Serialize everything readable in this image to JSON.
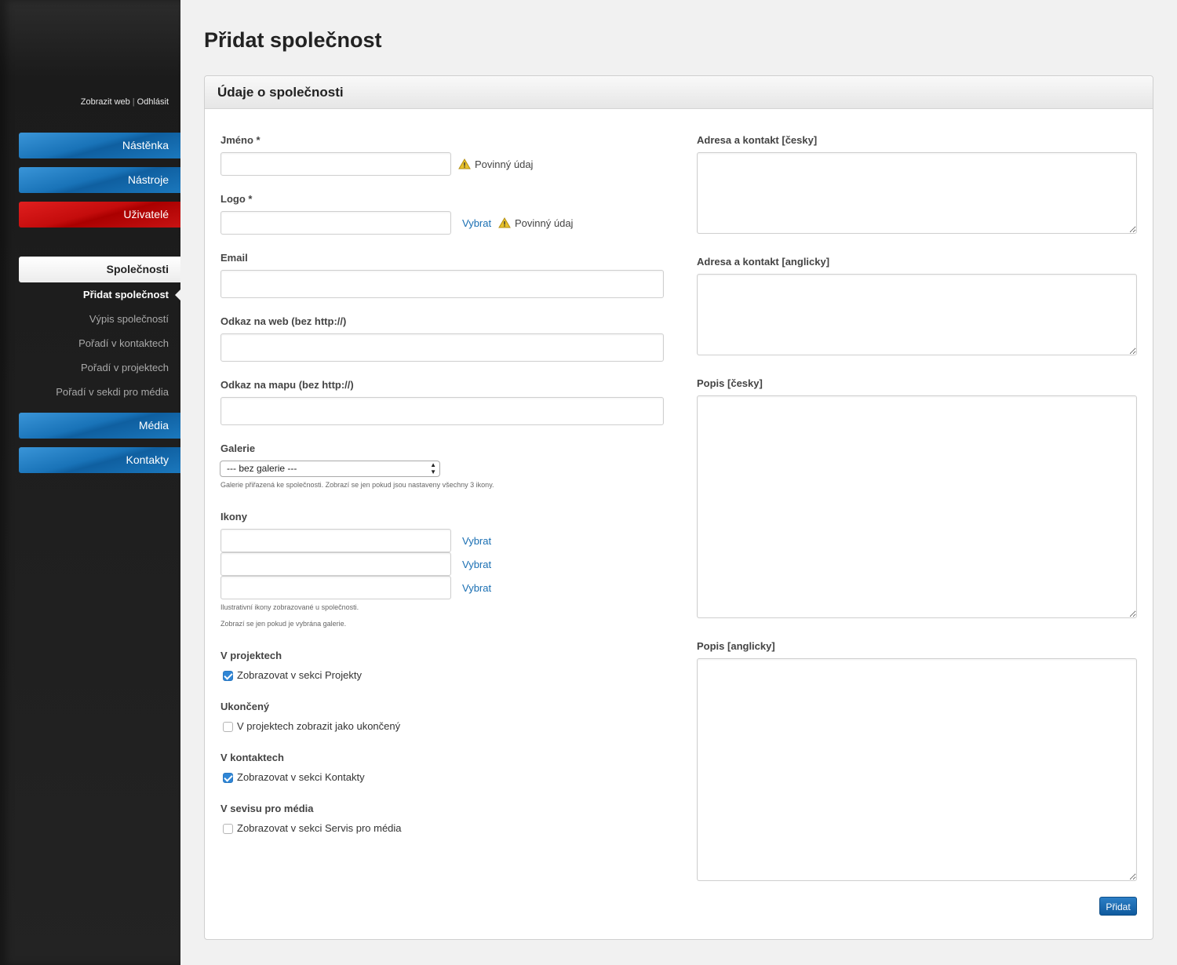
{
  "header": {
    "view_web": "Zobrazit web",
    "separator": "|",
    "logout": "Odhlásit"
  },
  "nav": {
    "dashboard": "Nástěnka",
    "tools": "Nástroje",
    "users": "Uživatelé",
    "companies": "Společnosti",
    "media": "Média",
    "contacts": "Kontakty"
  },
  "subnav": {
    "add_company": "Přidat společnost",
    "list_companies": "Výpis společností",
    "order_contacts": "Pořadí v kontaktech",
    "order_projects": "Pořadí v projektech",
    "order_media": "Pořadí v sekdi pro média"
  },
  "page": {
    "title": "Přidat společnost",
    "panel_title": "Údaje o společnosti"
  },
  "form": {
    "name_label": "Jméno *",
    "name_value": "",
    "required_text": "Povinný údaj",
    "logo_label": "Logo *",
    "logo_value": "",
    "select_link": "Vybrat",
    "email_label": "Email",
    "email_value": "",
    "web_label": "Odkaz na web (bez http://)",
    "web_value": "",
    "map_label": "Odkaz na mapu (bez http://)",
    "map_value": "",
    "gallery_label": "Galerie",
    "gallery_selected": "--- bez galerie ---",
    "gallery_hint": "Galerie přiřazená ke společnosti. Zobrazí se jen pokud jsou nastaveny všechny 3 ikony.",
    "icons_label": "Ikony",
    "icons_values": [
      "",
      "",
      ""
    ],
    "icons_hint1": "Ilustrativní ikony zobrazované u společnosti.",
    "icons_hint2": "Zobrazí se jen pokud je vybrána galerie.",
    "projects_label": "V projektech",
    "projects_cb": "Zobrazovat v sekci Projekty",
    "projects_checked": true,
    "finished_label": "Ukončený",
    "finished_cb": "V projektech zobrazit jako ukončený",
    "finished_checked": false,
    "contacts_label": "V kontaktech",
    "contacts_cb": "Zobrazovat v sekci Kontakty",
    "contacts_checked": true,
    "media_label": "V sevisu pro média",
    "media_cb": "Zobrazovat v sekci Servis pro média",
    "media_checked": false,
    "address_cz_label": "Adresa a kontakt [česky]",
    "address_en_label": "Adresa a kontakt [anglicky]",
    "desc_cz_label": "Popis [česky]",
    "desc_en_label": "Popis [anglicky]",
    "submit": "Přidat"
  },
  "colors": {
    "nav_blue": "#1973b8",
    "nav_red": "#c40c0c",
    "link": "#1a6fb3",
    "warning": "#e8c12a"
  }
}
